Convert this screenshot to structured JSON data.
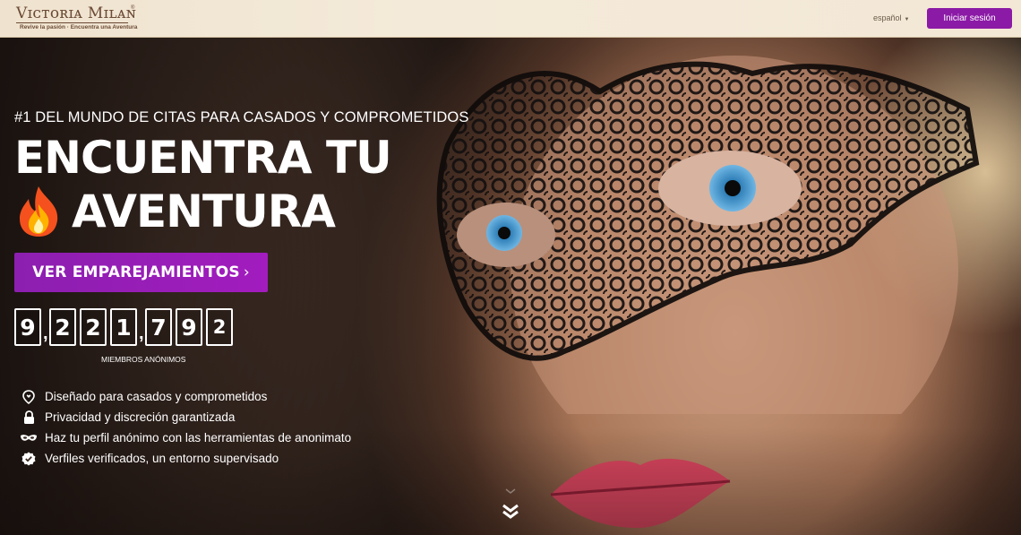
{
  "header": {
    "logo_text": "VICTORIA MILAN",
    "logo_tagline": "Revive la pasión · Encuentra una Aventura",
    "language": "español",
    "login_button": "Iniciar sesión"
  },
  "hero": {
    "subtitle": "#1 DEL MUNDO DE CITAS PARA CASADOS Y COMPROMETIDOS",
    "headline_line1": "ENCUENTRA TU",
    "headline_line2": "AVENTURA",
    "cta_label": "VER EMPAREJAMIENTOS",
    "cta_chevron": "›",
    "member_count": "9,221,792",
    "member_digits": [
      "9",
      "2",
      "2",
      "1",
      "7",
      "9",
      "2"
    ],
    "counter_label": "MIEMBROS ANÓNIMOS"
  },
  "features": [
    {
      "icon": "heart-pin-icon",
      "text": "Diseñado para casados y comprometidos"
    },
    {
      "icon": "lock-icon",
      "text": "Privacidad y discreción garantizada"
    },
    {
      "icon": "mask-icon",
      "text": "Haz tu perfil anónimo con las herramientas de anonimato"
    },
    {
      "icon": "verified-check-icon",
      "text": "Verfiles verificados, un entorno supervisado"
    }
  ],
  "colors": {
    "accent_purple": "#8b1aa6",
    "header_bg": "#f3e8d6",
    "logo_brown": "#6b4a35"
  }
}
